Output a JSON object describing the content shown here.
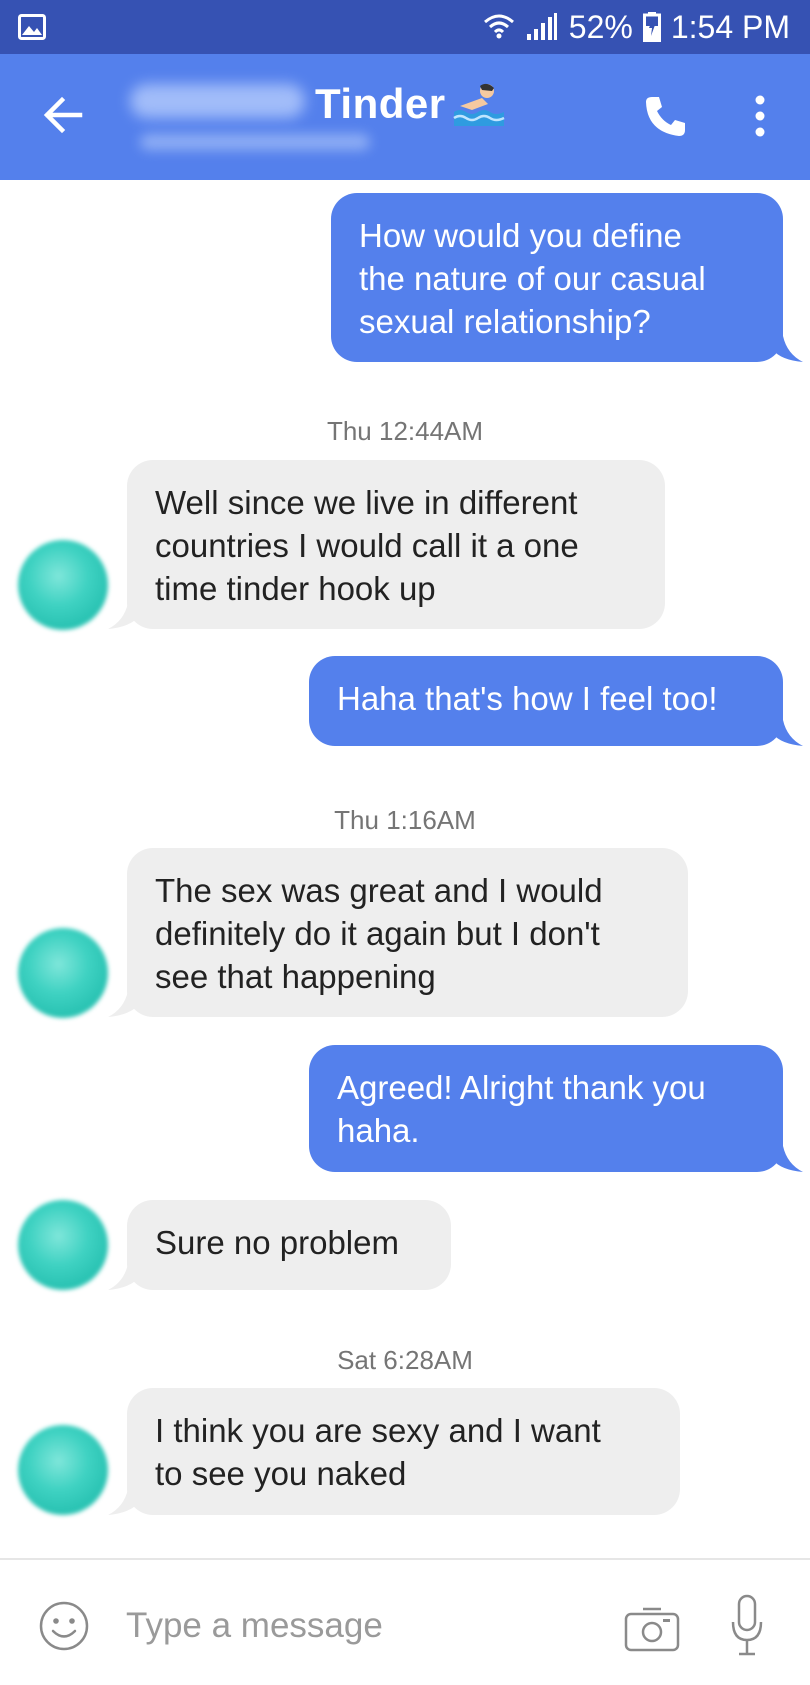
{
  "status_bar": {
    "battery": "52%",
    "time": "1:54 PM"
  },
  "header": {
    "title": "Tinder"
  },
  "messages": [
    {
      "type": "outgoing",
      "lines": [
        "How would you define",
        "the nature of our casual",
        "sexual relationship?"
      ]
    },
    {
      "type": "timestamp",
      "text": "Thu 12:44AM"
    },
    {
      "type": "incoming",
      "lines": [
        "Well since we live in different",
        "countries I would call it a one",
        "time tinder hook up"
      ]
    },
    {
      "type": "outgoing",
      "lines": [
        "Haha that's how I feel too!"
      ]
    },
    {
      "type": "timestamp",
      "text": "Thu 1:16AM"
    },
    {
      "type": "incoming",
      "lines": [
        "The sex was great and I would",
        "definitely do it again but I don't",
        "see that happening"
      ]
    },
    {
      "type": "outgoing",
      "lines": [
        "Agreed! Alright thank you",
        "haha."
      ]
    },
    {
      "type": "incoming",
      "lines": [
        "Sure no problem"
      ]
    },
    {
      "type": "timestamp",
      "text": "Sat 6:28AM"
    },
    {
      "type": "incoming",
      "lines": [
        "I think you are sexy and I want",
        "to see you naked"
      ]
    }
  ],
  "composer": {
    "placeholder": "Type a message"
  },
  "colors": {
    "status_bar": "#3652b3",
    "app_bar": "#5480ec",
    "outgoing_bubble": "#5480ec",
    "incoming_bubble": "#eeeeee",
    "avatar": "#3fd2c2"
  }
}
